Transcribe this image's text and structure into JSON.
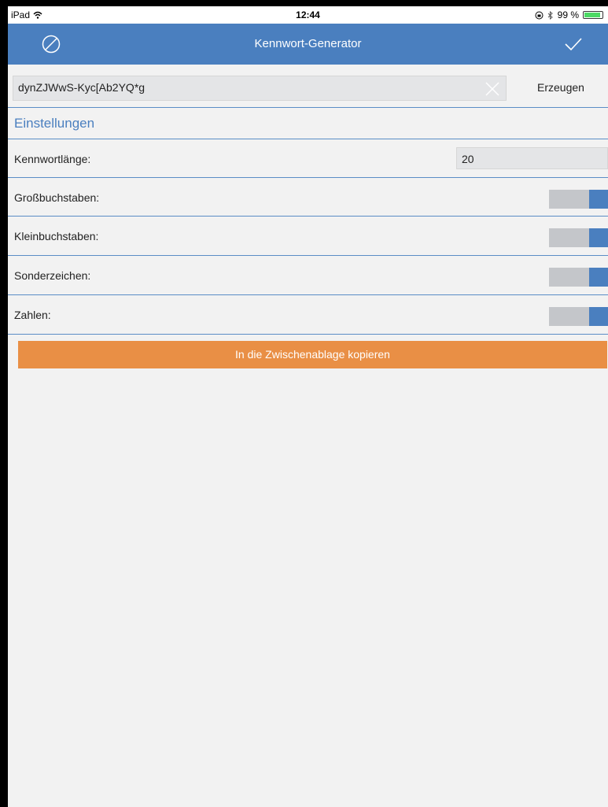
{
  "status_bar": {
    "device": "iPad",
    "time": "12:44",
    "battery": "99 %"
  },
  "nav": {
    "title": "Kennwort-Generator",
    "cancel_icon": "cancel-circle-icon",
    "confirm_icon": "checkmark-icon"
  },
  "password": {
    "value": "dynZJWwS-Kyc[Ab2YQ*g",
    "generate_label": "Erzeugen"
  },
  "settings": {
    "title": "Einstellungen",
    "length": {
      "label": "Kennwortlänge:",
      "value": "20"
    },
    "uppercase": {
      "label": "Großbuchstaben:",
      "on": true
    },
    "lowercase": {
      "label": "Kleinbuchstaben:",
      "on": true
    },
    "special": {
      "label": "Sonderzeichen:",
      "on": true
    },
    "numbers": {
      "label": "Zahlen:",
      "on": true
    }
  },
  "copy_button": {
    "label": "In die Zwischenablage kopieren"
  },
  "colors": {
    "accent": "#4a7fbf",
    "copy_button": "#e98f45",
    "toggle_track": "#c4c6ca"
  }
}
